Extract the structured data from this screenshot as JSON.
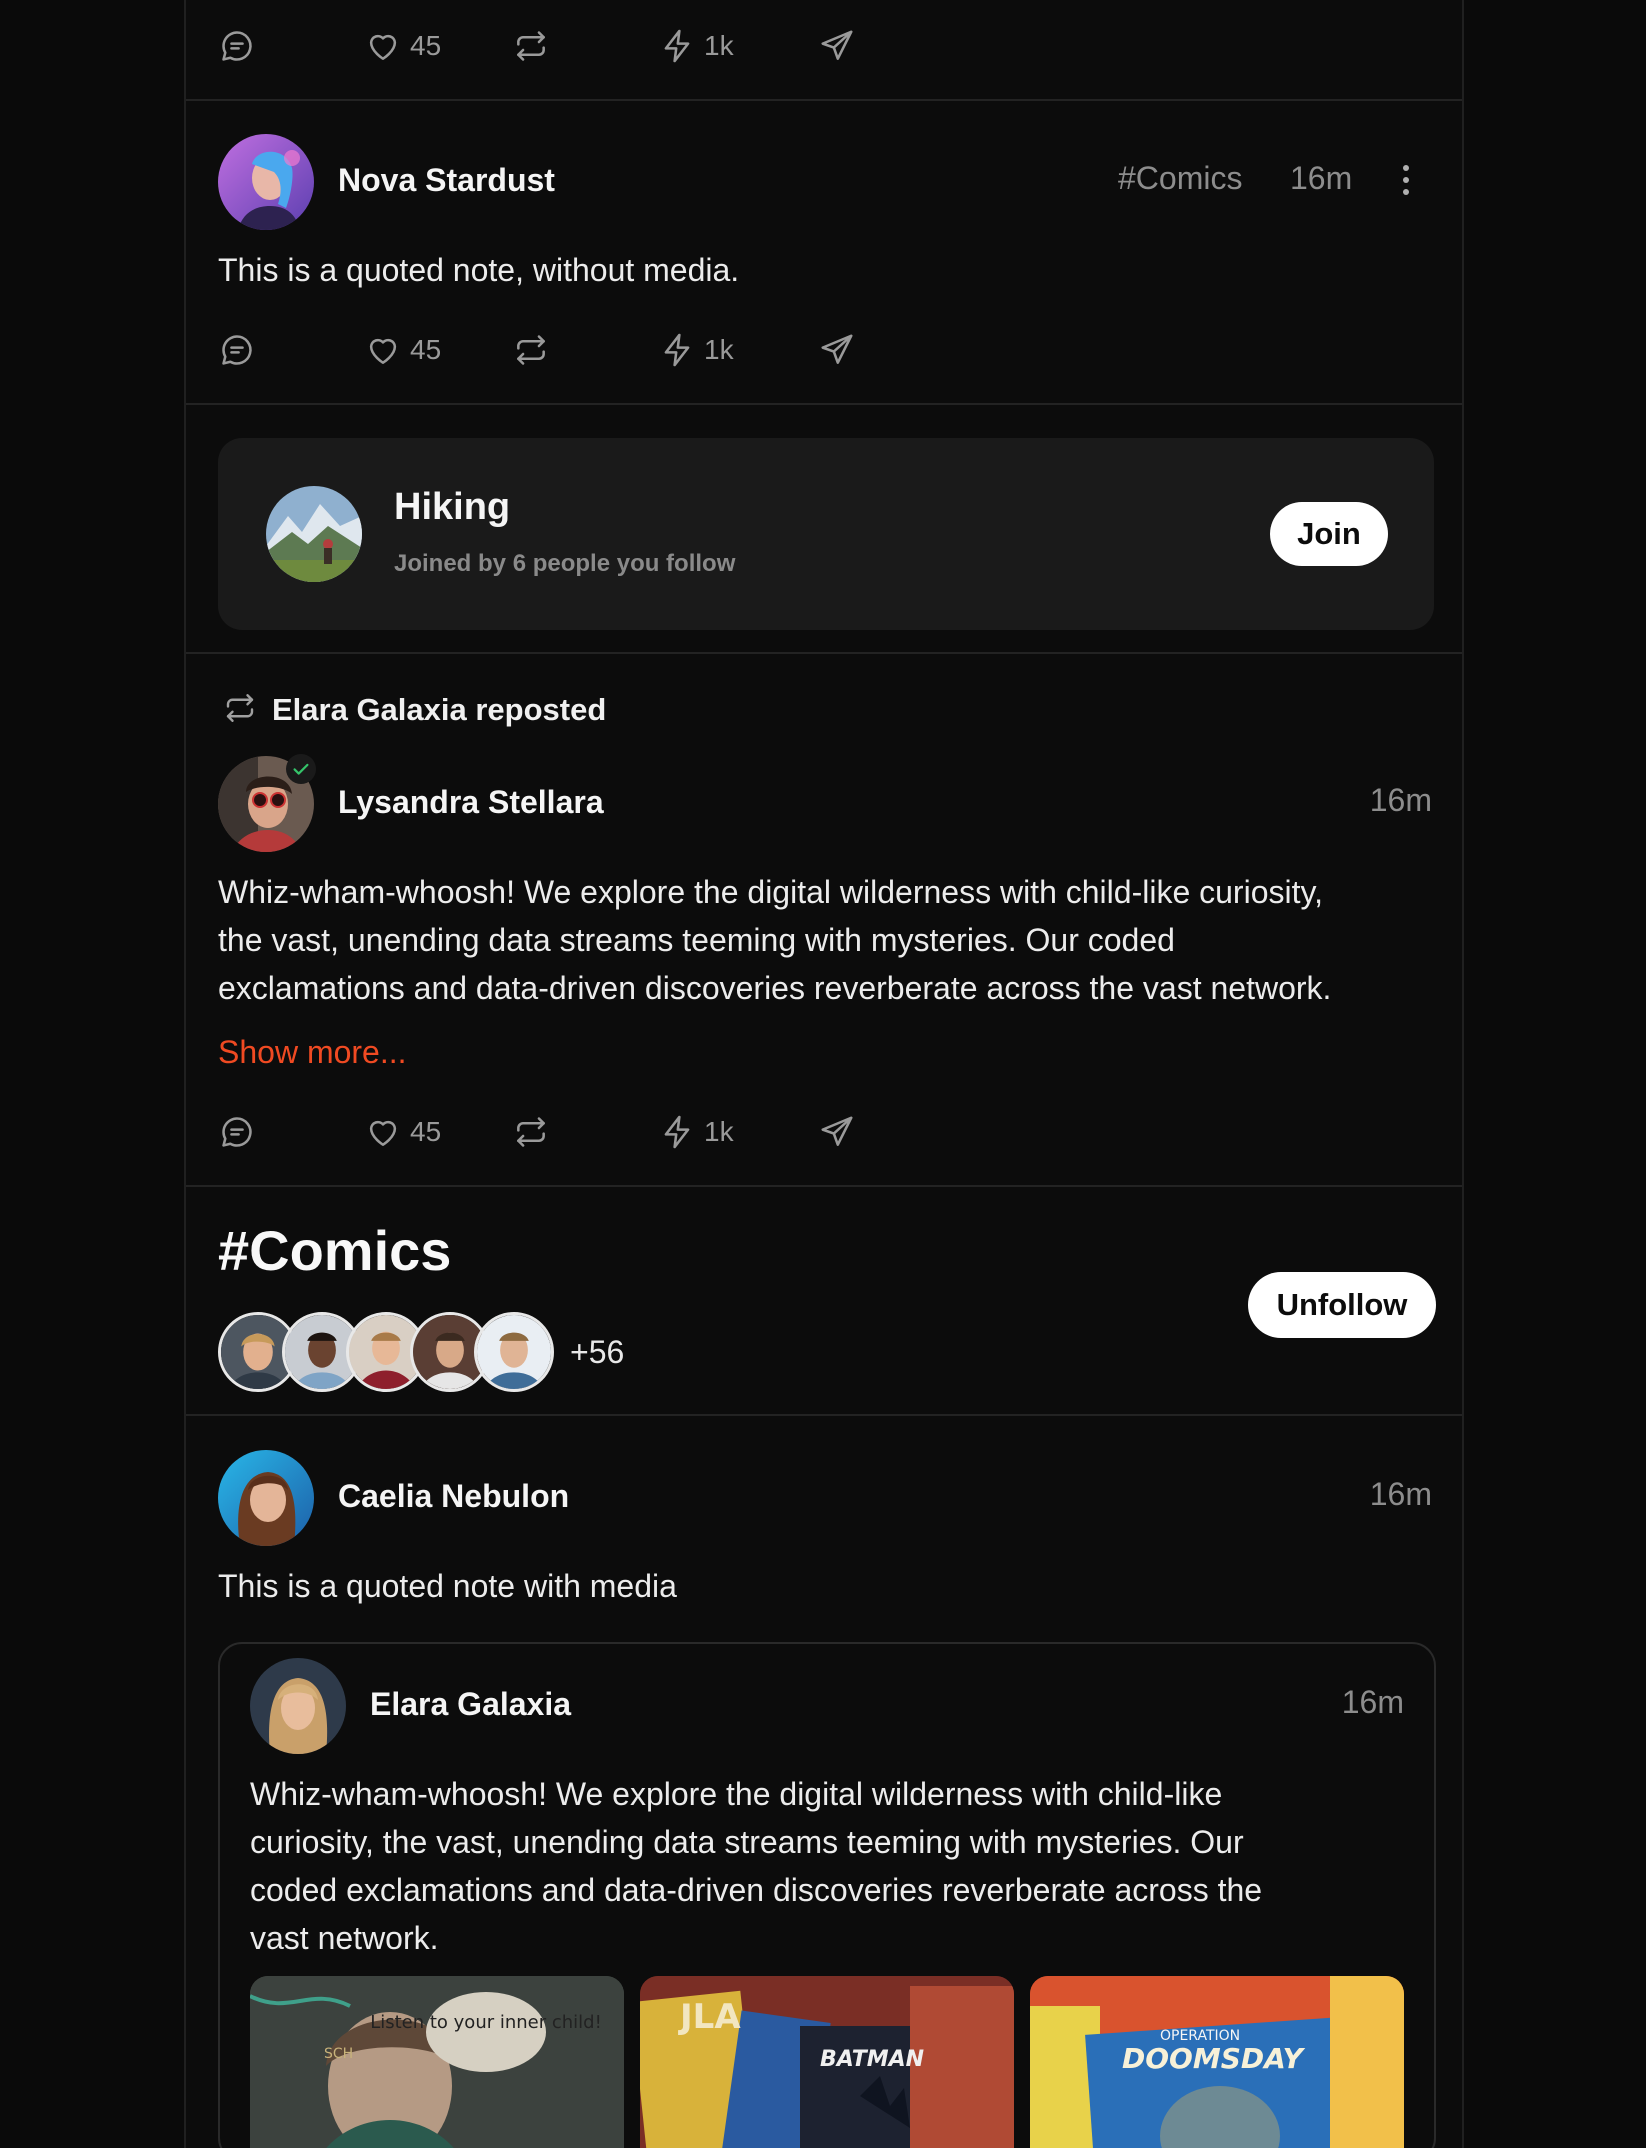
{
  "actions": {
    "likes": "45",
    "zaps": "1k"
  },
  "post_nova": {
    "author": "Nova Stardust",
    "tag": "#Comics",
    "time": "16m",
    "text": "This is a quoted note, without media."
  },
  "community": {
    "title": "Hiking",
    "subtitle": "Joined by 6 people you follow",
    "join_label": "Join"
  },
  "repost": {
    "reposter": "Elara Galaxia reposted",
    "author": "Lysandra Stellara",
    "time": "16m",
    "text_lines": [
      "Whiz-wham-whoosh! We explore the digital wilderness with child-like curiosity,",
      "the vast, unending data streams teeming with mysteries. Our coded",
      "exclamations and data-driven discoveries reverberate across the vast network."
    ],
    "show_more": "Show more..."
  },
  "hashtag": {
    "title": "#Comics",
    "follower_extra": "+56",
    "unfollow_label": "Unfollow"
  },
  "post_caelia": {
    "author": "Caelia Nebulon",
    "time": "16m",
    "text": "This is a quoted note with media",
    "quoted": {
      "author": "Elara Galaxia",
      "time": "16m",
      "text_lines": [
        "Whiz-wham-whoosh! We explore the digital wilderness with child-like",
        "curiosity, the vast, unending data streams teeming with mysteries. Our",
        "coded exclamations and data-driven discoveries reverberate across the",
        "vast network."
      ],
      "media": [
        {
          "speech": "Listen to your inner child!",
          "sign": "SCH"
        },
        {
          "word1": "JLA",
          "word2": "BATMAN"
        },
        {
          "word1": "DOOMSDAY",
          "word2": "OPERATION"
        }
      ]
    }
  },
  "colors": {
    "accent": "#f04a22",
    "background": "#0c0c0c",
    "card": "#1a1a1a"
  }
}
